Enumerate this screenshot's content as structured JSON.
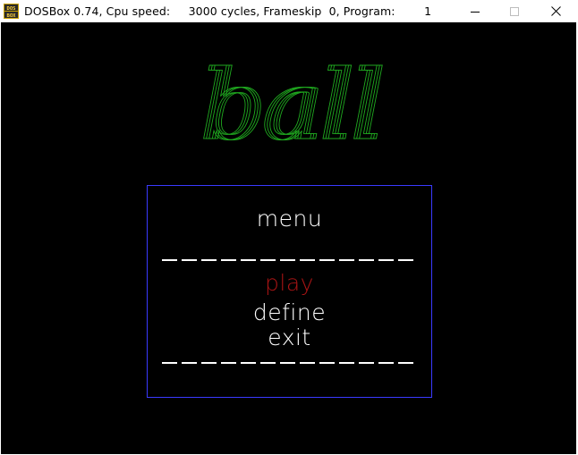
{
  "window": {
    "title": "DOSBox 0.74, Cpu speed:     3000 cycles, Frameskip  0, Program:        1",
    "icon": "dosbox-icon",
    "controls": {
      "minimize": "minimize-icon",
      "maximize": "maximize-icon",
      "close": "close-icon"
    }
  },
  "game": {
    "logo": "ball",
    "logo_color": "#1fa81f",
    "menu": {
      "title": "menu",
      "items": [
        {
          "label": "play",
          "selected": true
        },
        {
          "label": "define",
          "selected": false
        },
        {
          "label": "exit",
          "selected": false
        }
      ],
      "selected_color": "#a81414",
      "text_color": "#ffffff",
      "border_color": "#3a3aff"
    }
  }
}
